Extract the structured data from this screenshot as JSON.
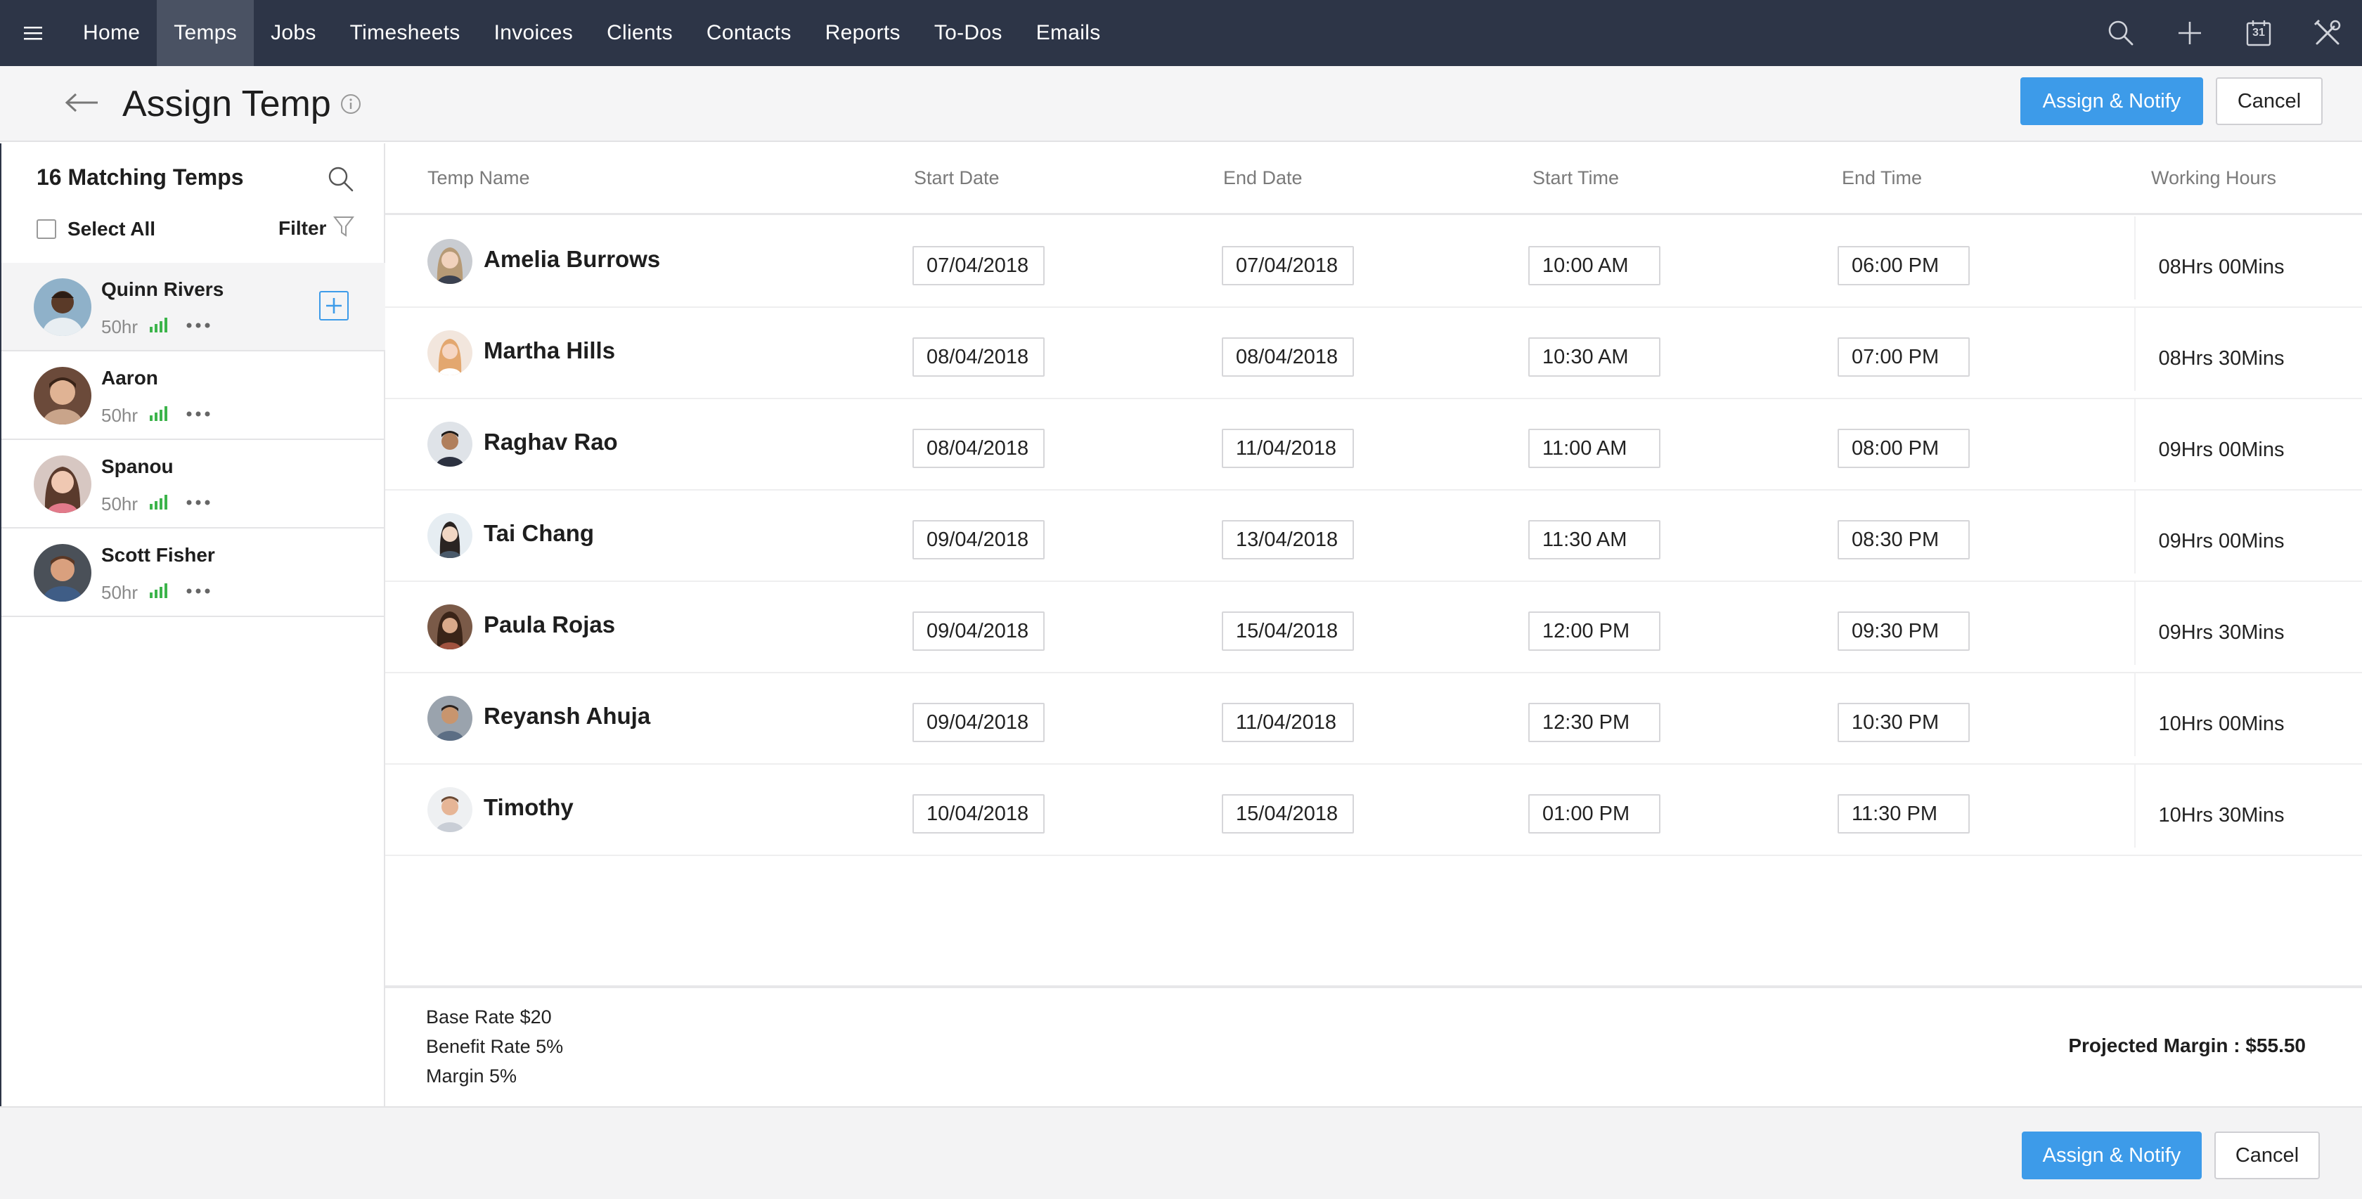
{
  "nav": {
    "items": [
      {
        "label": "Home",
        "active": false
      },
      {
        "label": "Temps",
        "active": true
      },
      {
        "label": "Jobs",
        "active": false
      },
      {
        "label": "Timesheets",
        "active": false
      },
      {
        "label": "Invoices",
        "active": false
      },
      {
        "label": "Clients",
        "active": false
      },
      {
        "label": "Contacts",
        "active": false
      },
      {
        "label": "Reports",
        "active": false
      },
      {
        "label": "To-Dos",
        "active": false
      },
      {
        "label": "Emails",
        "active": false
      }
    ],
    "calendar_day": "31",
    "icons": [
      "menu-icon",
      "search-icon",
      "plus-icon",
      "calendar-icon",
      "tools-icon"
    ]
  },
  "header": {
    "title": "Assign Temp",
    "assign_label": "Assign & Notify",
    "cancel_label": "Cancel"
  },
  "sidebar": {
    "title": "16 Matching Temps",
    "select_all": "Select All",
    "filter": "Filter",
    "temps": [
      {
        "name": "Quinn Rivers",
        "hours": "50hr",
        "selected": true
      },
      {
        "name": "Aaron",
        "hours": "50hr",
        "selected": false
      },
      {
        "name": "Spanou",
        "hours": "50hr",
        "selected": false
      },
      {
        "name": "Scott Fisher",
        "hours": "50hr",
        "selected": false
      }
    ]
  },
  "table": {
    "headers": {
      "temp_name": "Temp Name",
      "start_date": "Start Date",
      "end_date": "End Date",
      "start_time": "Start Time",
      "end_time": "End Time",
      "working_hours": "Working Hours"
    },
    "rows": [
      {
        "name": "Amelia Burrows",
        "start_date": "07/04/2018",
        "end_date": "07/04/2018",
        "start_time": "10:00 AM",
        "end_time": "06:00 PM",
        "hours": "08Hrs 00Mins"
      },
      {
        "name": "Martha Hills",
        "start_date": "08/04/2018",
        "end_date": "08/04/2018",
        "start_time": "10:30 AM",
        "end_time": "07:00 PM",
        "hours": "08Hrs 30Mins"
      },
      {
        "name": "Raghav Rao",
        "start_date": "08/04/2018",
        "end_date": "11/04/2018",
        "start_time": "11:00 AM",
        "end_time": "08:00 PM",
        "hours": "09Hrs 00Mins"
      },
      {
        "name": "Tai Chang",
        "start_date": "09/04/2018",
        "end_date": "13/04/2018",
        "start_time": "11:30 AM",
        "end_time": "08:30 PM",
        "hours": "09Hrs 00Mins"
      },
      {
        "name": "Paula Rojas",
        "start_date": "09/04/2018",
        "end_date": "15/04/2018",
        "start_time": "12:00 PM",
        "end_time": "09:30 PM",
        "hours": "09Hrs 30Mins"
      },
      {
        "name": "Reyansh Ahuja",
        "start_date": "09/04/2018",
        "end_date": "11/04/2018",
        "start_time": "12:30 PM",
        "end_time": "10:30 PM",
        "hours": "10Hrs 00Mins"
      },
      {
        "name": "Timothy",
        "start_date": "10/04/2018",
        "end_date": "15/04/2018",
        "start_time": "01:00 PM",
        "end_time": "11:30 PM",
        "hours": "10Hrs 30Mins"
      }
    ]
  },
  "rates": {
    "base": "Base Rate $20",
    "benefit": "Benefit Rate 5%",
    "margin": "Margin 5%",
    "projected": "Projected Margin : $55.50"
  },
  "footer": {
    "assign_label": "Assign & Notify",
    "cancel_label": "Cancel"
  },
  "colors": {
    "nav_bg": "#2d3547",
    "nav_active": "#4a5263",
    "accent": "#3d9be9",
    "signal": "#3cb44b"
  }
}
